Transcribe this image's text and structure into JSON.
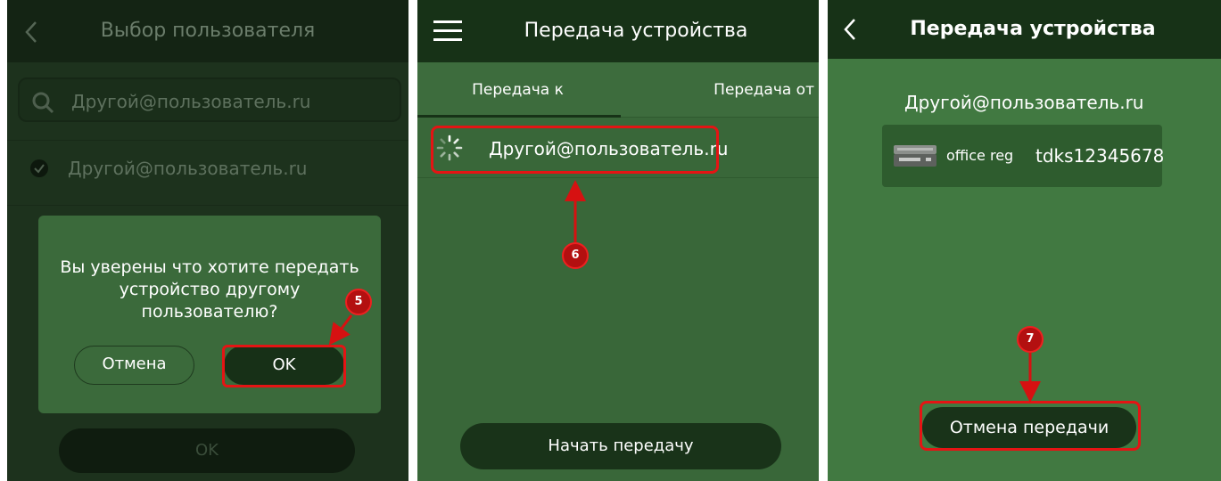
{
  "panel1": {
    "title": "Выбор пользователя",
    "search_value": "Другой@пользователь.ru",
    "user_row": "Другой@пользователь.ru",
    "dialog": {
      "message": "Вы уверены что хотите передать устройство другому пользователю?",
      "cancel_label": "Отмена",
      "ok_label": "OK"
    },
    "bottom_ok_label": "OK",
    "marker": "5"
  },
  "panel2": {
    "title": "Передача устройства",
    "tabs": [
      {
        "label": "Передача к",
        "active": true
      },
      {
        "label": "Передача от",
        "active": false
      }
    ],
    "user_row": "Другой@пользователь.ru",
    "start_button": "Начать передачу",
    "marker": "6"
  },
  "panel3": {
    "title": "Передача устройства",
    "user": "Другой@пользователь.ru",
    "device": {
      "icon": "dvr-recorder-icon",
      "name": "office reg",
      "serial": "tdks12345678"
    },
    "cancel_button": "Отмена передачи",
    "marker": "7"
  },
  "colors": {
    "highlight": "#e41414",
    "header_dark": "#173217",
    "panel_green": "#396739",
    "button_dark": "#193319"
  }
}
